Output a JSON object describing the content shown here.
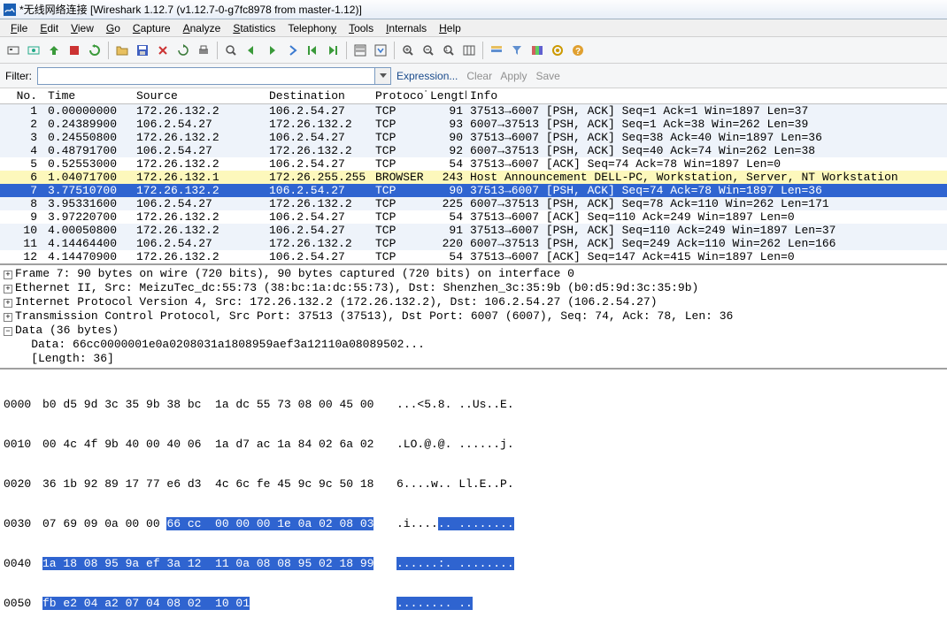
{
  "window": {
    "title": "*无线网络连接   [Wireshark 1.12.7  (v1.12.7-0-g7fc8978 from master-1.12)]"
  },
  "menu": {
    "file": "File",
    "edit": "Edit",
    "view": "View",
    "go": "Go",
    "capture": "Capture",
    "analyze": "Analyze",
    "statistics": "Statistics",
    "telephony": "Telephony",
    "tools": "Tools",
    "internals": "Internals",
    "help": "Help"
  },
  "filter": {
    "label": "Filter:",
    "value": "",
    "expression": "Expression...",
    "clear": "Clear",
    "apply": "Apply",
    "save": "Save"
  },
  "columns": {
    "no": "No.",
    "time": "Time",
    "source": "Source",
    "destination": "Destination",
    "protocol": "Protocol",
    "length": "Length",
    "info": "Info"
  },
  "packets": [
    {
      "no": "1",
      "time": "0.00000000",
      "src": "172.26.132.2",
      "dst": "106.2.54.27",
      "proto": "TCP",
      "len": "91",
      "info": "37513→6007 [PSH, ACK] Seq=1 Ack=1 Win=1897 Len=37",
      "cls": "row-light"
    },
    {
      "no": "2",
      "time": "0.24389900",
      "src": "106.2.54.27",
      "dst": "172.26.132.2",
      "proto": "TCP",
      "len": "93",
      "info": "6007→37513 [PSH, ACK] Seq=1 Ack=38 Win=262 Len=39",
      "cls": "row-light"
    },
    {
      "no": "3",
      "time": "0.24550800",
      "src": "172.26.132.2",
      "dst": "106.2.54.27",
      "proto": "TCP",
      "len": "90",
      "info": "37513→6007 [PSH, ACK] Seq=38 Ack=40 Win=1897 Len=36",
      "cls": "row-light"
    },
    {
      "no": "4",
      "time": "0.48791700",
      "src": "106.2.54.27",
      "dst": "172.26.132.2",
      "proto": "TCP",
      "len": "92",
      "info": "6007→37513 [PSH, ACK] Seq=40 Ack=74 Win=262 Len=38",
      "cls": "row-light"
    },
    {
      "no": "5",
      "time": "0.52553000",
      "src": "172.26.132.2",
      "dst": "106.2.54.27",
      "proto": "TCP",
      "len": "54",
      "info": "37513→6007 [ACK] Seq=74 Ack=78 Win=1897 Len=0",
      "cls": "row-white"
    },
    {
      "no": "6",
      "time": "1.04071700",
      "src": "172.26.132.1",
      "dst": "172.26.255.255",
      "proto": "BROWSER",
      "len": "243",
      "info": "Host Announcement DELL-PC, Workstation, Server, NT Workstation",
      "cls": "row-yellow"
    },
    {
      "no": "7",
      "time": "3.77510700",
      "src": "172.26.132.2",
      "dst": "106.2.54.27",
      "proto": "TCP",
      "len": "90",
      "info": "37513→6007 [PSH, ACK] Seq=74 Ack=78 Win=1897 Len=36",
      "cls": "row-selected"
    },
    {
      "no": "8",
      "time": "3.95331600",
      "src": "106.2.54.27",
      "dst": "172.26.132.2",
      "proto": "TCP",
      "len": "225",
      "info": "6007→37513 [PSH, ACK] Seq=78 Ack=110 Win=262 Len=171",
      "cls": "row-light"
    },
    {
      "no": "9",
      "time": "3.97220700",
      "src": "172.26.132.2",
      "dst": "106.2.54.27",
      "proto": "TCP",
      "len": "54",
      "info": "37513→6007 [ACK] Seq=110 Ack=249 Win=1897 Len=0",
      "cls": "row-white"
    },
    {
      "no": "10",
      "time": "4.00050800",
      "src": "172.26.132.2",
      "dst": "106.2.54.27",
      "proto": "TCP",
      "len": "91",
      "info": "37513→6007 [PSH, ACK] Seq=110 Ack=249 Win=1897 Len=37",
      "cls": "row-light"
    },
    {
      "no": "11",
      "time": "4.14464400",
      "src": "106.2.54.27",
      "dst": "172.26.132.2",
      "proto": "TCP",
      "len": "220",
      "info": "6007→37513 [PSH, ACK] Seq=249 Ack=110 Win=262 Len=166",
      "cls": "row-light"
    },
    {
      "no": "12",
      "time": "4.14470900",
      "src": "172.26.132.2",
      "dst": "106.2.54.27",
      "proto": "TCP",
      "len": "54",
      "info": "37513→6007 [ACK] Seq=147 Ack=415 Win=1897 Len=0",
      "cls": "row-white"
    }
  ],
  "details": {
    "frame": "Frame 7: 90 bytes on wire (720 bits), 90 bytes captured (720 bits) on interface 0",
    "eth": "Ethernet II, Src: MeizuTec_dc:55:73 (38:bc:1a:dc:55:73), Dst: Shenzhen_3c:35:9b (b0:d5:9d:3c:35:9b)",
    "ip": "Internet Protocol Version 4, Src: 172.26.132.2 (172.26.132.2), Dst: 106.2.54.27 (106.2.54.27)",
    "tcp": "Transmission Control Protocol, Src Port: 37513 (37513), Dst Port: 6007 (6007), Seq: 74, Ack: 78, Len: 36",
    "data_hdr": "Data (36 bytes)",
    "data_line": "    Data: 66cc0000001e0a0208031a1808959aef3a12110a08089502...",
    "len_line": "    [Length: 36]"
  },
  "hex": [
    {
      "off": "0000",
      "b": "b0 d5 9d 3c 35 9b 38 bc  1a dc 55 73 08 00 45 00",
      "a": "...<5.8. ..Us..E."
    },
    {
      "off": "0010",
      "b": "00 4c 4f 9b 40 00 40 06  1a d7 ac 1a 84 02 6a 02",
      "a": ".LO.@.@. ......j."
    },
    {
      "off": "0020",
      "b": "36 1b 92 89 17 77 e6 d3  4c 6c fe 45 9c 9c 50 18",
      "a": "6....w.. Ll.E..P."
    },
    {
      "off": "0030",
      "b1": "07 69 09 0a 00 00 ",
      "b2": "66 cc  00 00 00 1e 0a 02 08 03",
      "a1": ".i....",
      "a2": ".. ........"
    },
    {
      "off": "0040",
      "b2": "1a 18 08 95 9a ef 3a 12  11 0a 08 08 95 02 18 99",
      "a2": "......:. ........"
    },
    {
      "off": "0050",
      "b2": "fb e2 04 a2 07 04 08 02  10 01",
      "a2": "........ .."
    }
  ]
}
